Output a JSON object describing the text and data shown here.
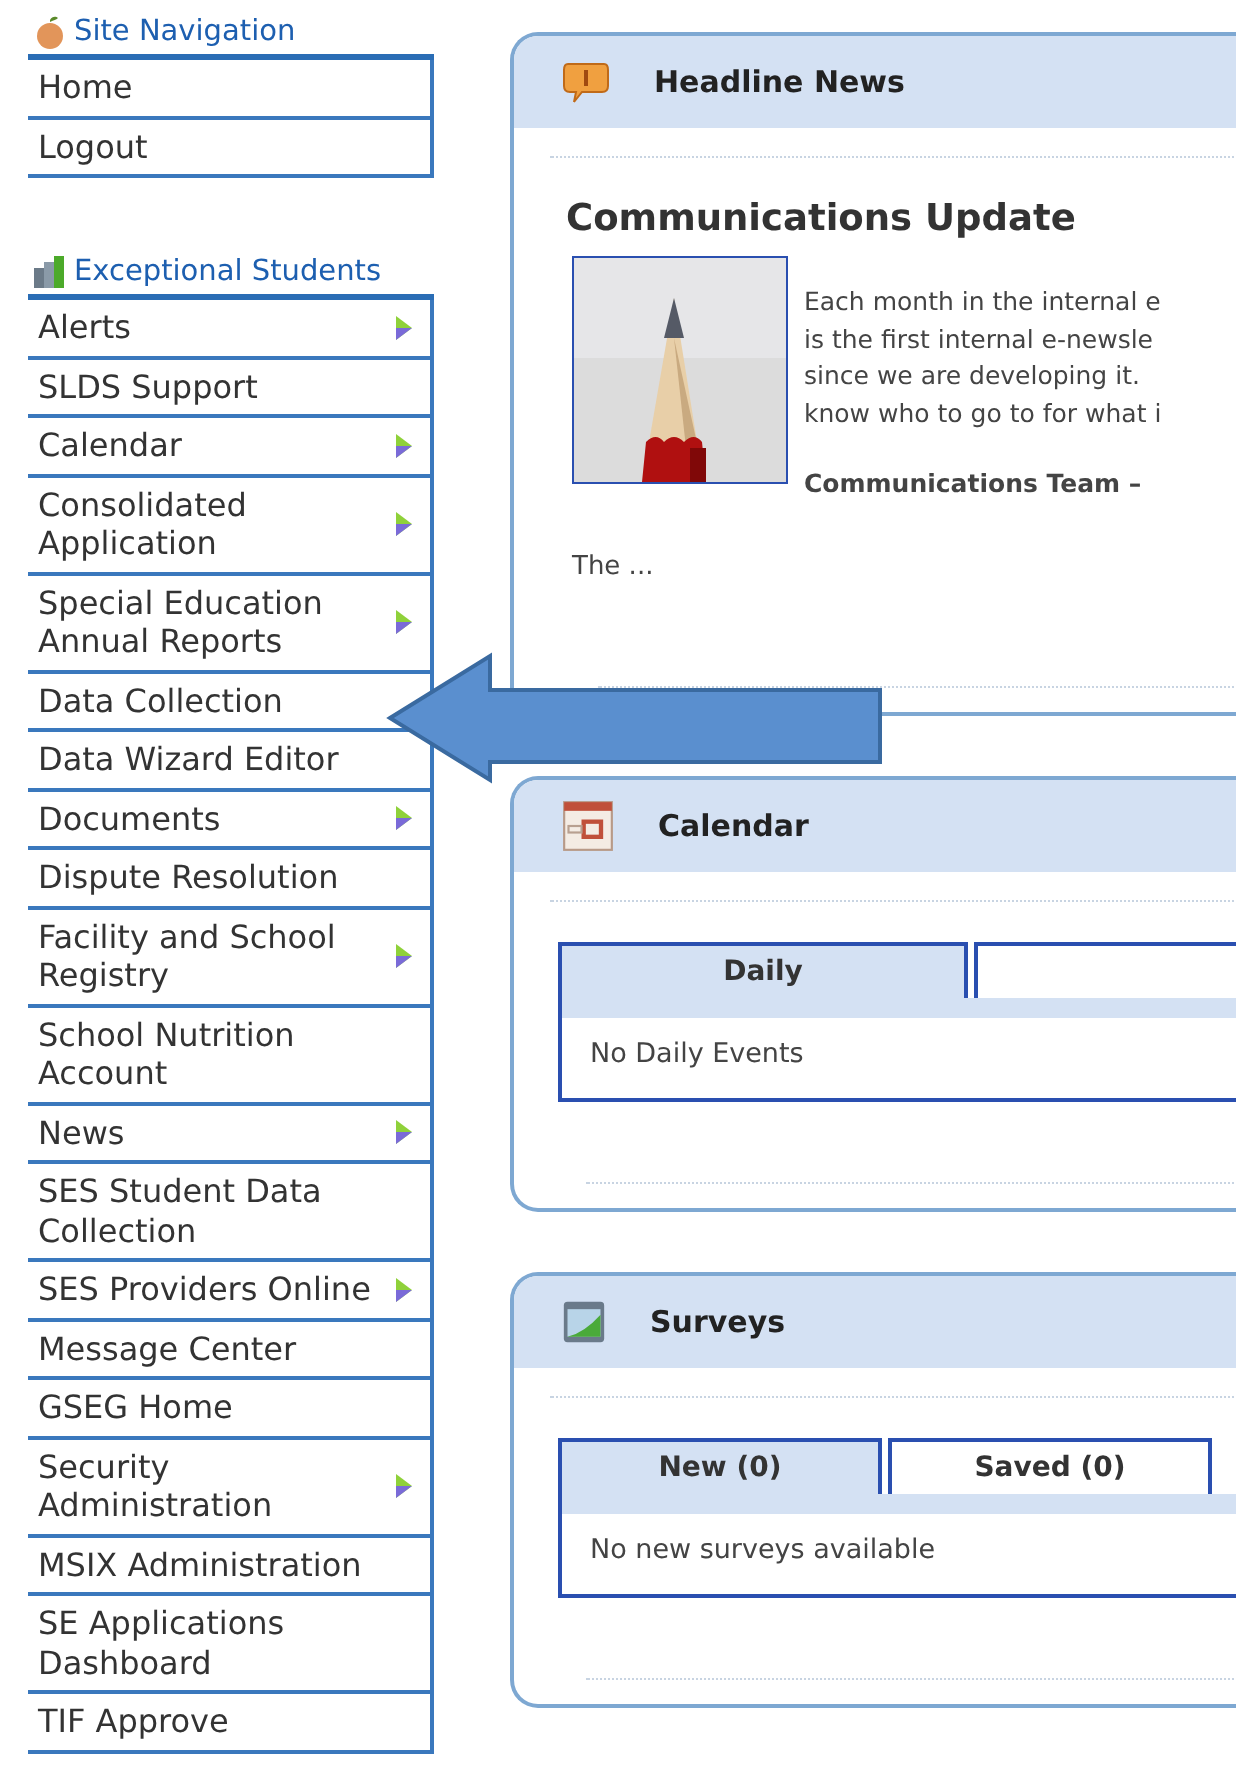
{
  "sidebar": {
    "sections": [
      {
        "title": "Site Navigation",
        "items": [
          {
            "label": "Home",
            "has_submenu": false
          },
          {
            "label": "Logout",
            "has_submenu": false
          }
        ]
      },
      {
        "title": "Exceptional Students",
        "items": [
          {
            "label": "Alerts",
            "has_submenu": true
          },
          {
            "label": "SLDS Support",
            "has_submenu": false
          },
          {
            "label": "Calendar",
            "has_submenu": true
          },
          {
            "label": "Consolidated Application",
            "has_submenu": true
          },
          {
            "label": "Special Education Annual Reports",
            "has_submenu": true
          },
          {
            "label": "Data Collection",
            "has_submenu": false
          },
          {
            "label": "Data Wizard Editor",
            "has_submenu": false
          },
          {
            "label": "Documents",
            "has_submenu": true
          },
          {
            "label": "Dispute Resolution",
            "has_submenu": false
          },
          {
            "label": "Facility and School Registry",
            "has_submenu": true
          },
          {
            "label": "School Nutrition Account",
            "has_submenu": false
          },
          {
            "label": "News",
            "has_submenu": true
          },
          {
            "label": "SES Student Data Collection",
            "has_submenu": false
          },
          {
            "label": "SES Providers Online",
            "has_submenu": true
          },
          {
            "label": "Message Center",
            "has_submenu": false
          },
          {
            "label": "GSEG Home",
            "has_submenu": false
          },
          {
            "label": "Security Administration",
            "has_submenu": true
          },
          {
            "label": "MSIX Administration",
            "has_submenu": false
          },
          {
            "label": "SE Applications Dashboard",
            "has_submenu": false
          },
          {
            "label": "TIF Approve",
            "has_submenu": false
          }
        ]
      }
    ]
  },
  "panels": [
    {
      "kind": "news",
      "title": "Headline News",
      "article": {
        "title": "Communications Update",
        "lines": [
          "Each month in the internal e",
          "is the first internal e-newsle",
          "since we are developing it.",
          "know who to go to for what i"
        ],
        "byline": "Communications Team –",
        "teaser": "The ..."
      }
    },
    {
      "kind": "tabs",
      "title": "Calendar",
      "tabs": [
        {
          "label": "Daily",
          "selected": true
        },
        {
          "selected": false
        }
      ],
      "message": "No Daily Events"
    },
    {
      "kind": "tabs",
      "title": "Surveys",
      "tabs": [
        {
          "label": "New (0)",
          "selected": true
        },
        {
          "label": "Saved (0)",
          "selected": false
        }
      ],
      "message": "No new surveys available"
    }
  ]
}
